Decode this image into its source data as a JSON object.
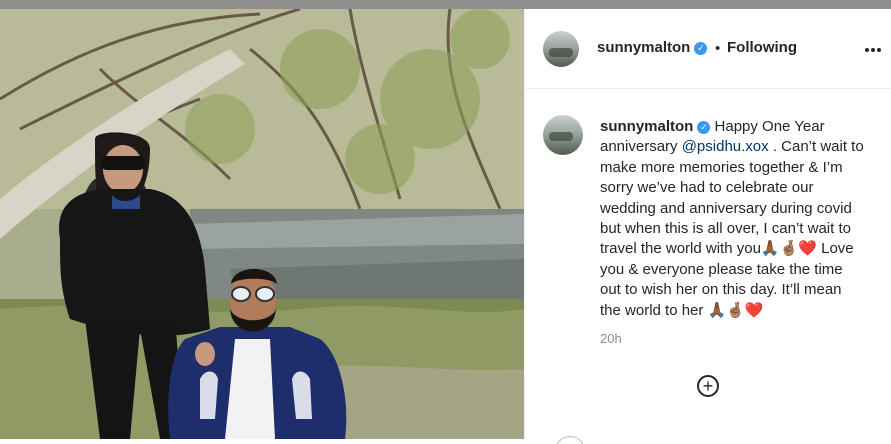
{
  "post": {
    "username": "sunnymalton",
    "verified_icon": "verified-badge-icon",
    "separator": "•",
    "follow_status": "Following",
    "more_icon": "more-options-icon"
  },
  "caption": {
    "username": "sunnymalton",
    "text_before_mention": "Happy One Year anniversary ",
    "mention": "@psidhu.xox",
    "text_after_mention": " . Can’t wait to make more memories together & I’m sorry we’ve had to celebrate our wedding and anniversary during covid but when this is all over, I can’t wait to travel the world with you",
    "emoji_1": "🙏🏾🤞🏽❤️",
    "text_line_2": " Love you & everyone please take the time out to wish her on this day. It’ll mean the world to her ",
    "emoji_2": "🙏🏾🤞🏽❤️",
    "time": "20h"
  },
  "load_more": {
    "icon": "plus-circle-icon",
    "symbol": "+"
  }
}
